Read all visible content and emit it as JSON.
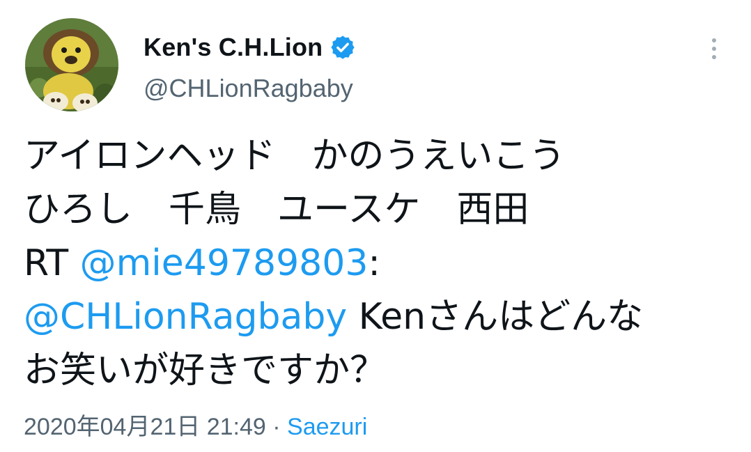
{
  "author": {
    "display_name": "Ken's C.H.Lion",
    "handle": "@CHLionRagbaby",
    "verified": true,
    "avatar_icon": "lion-plush-avatar"
  },
  "menu": {
    "icon": "more-vertical-icon"
  },
  "tweet": {
    "line1": "アイロンヘッド　かのうえいこう",
    "line2": "ひろし　千鳥　ユースケ　西田",
    "rt_prefix": "RT ",
    "rt_mention": "@mie49789803",
    "rt_colon": ":",
    "reply_mention": "@CHLionRagbaby",
    "line4_rest": " Kenさんはどんな",
    "line5": "お笑いが好きですか？"
  },
  "meta": {
    "timestamp": "2020年04月21日 21:49",
    "separator": " · ",
    "source": "Saezuri"
  },
  "colors": {
    "link": "#1d9bf0",
    "text": "#0f1419",
    "secondary": "#536471"
  }
}
